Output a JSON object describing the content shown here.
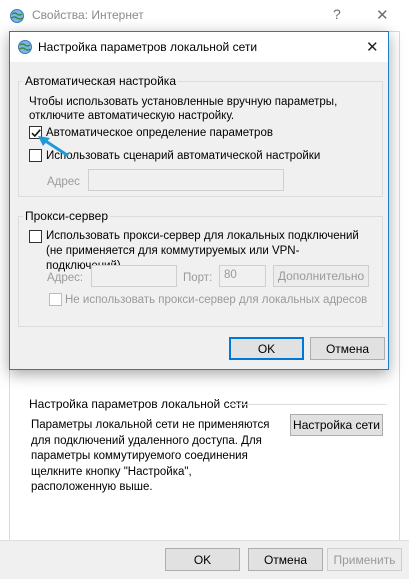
{
  "outer_window": {
    "title": "Свойства: Интернет",
    "help_glyph": "?",
    "close_glyph": "✕",
    "lan_section_heading": "Настройка параметров локальной сети",
    "lan_section_description": "Параметры локальной сети не применяются для подключений удаленного доступа. Для параметры коммутируемого соединения щелкните кнопку \"Настройка\", расположенную выше.",
    "lan_settings_button": "Настройка сети",
    "ok_button": "OK",
    "cancel_button": "Отмена",
    "apply_button": "Применить"
  },
  "dialog": {
    "title": "Настройка параметров локальной сети",
    "close_glyph": "✕",
    "auto_group": {
      "legend": "Автоматическая настройка",
      "description": "Чтобы использовать установленные вручную параметры, отключите автоматическую настройку.",
      "auto_detect_label": "Автоматическое определение параметров",
      "auto_detect_checked": true,
      "use_script_label": "Использовать сценарий автоматической настройки",
      "use_script_checked": false,
      "address_label": "Адрес",
      "address_value": ""
    },
    "proxy_group": {
      "legend": "Прокси-сервер",
      "use_proxy_label": "Использовать прокси-сервер для локальных подключений (не применяется для коммутируемых или VPN-подключений).",
      "use_proxy_checked": false,
      "address_label": "Адрес:",
      "address_value": "",
      "port_label": "Порт:",
      "port_value": "80",
      "advanced_button": "Дополнительно",
      "bypass_label": "Не использовать прокси-сервер для локальных адресов",
      "bypass_checked": false
    },
    "ok_button": "OK",
    "cancel_button": "Отмена"
  },
  "colors": {
    "accent": "#0078d7",
    "arrow": "#1e9bd7"
  },
  "icons": [
    "globe-network-icon",
    "checkmark-icon",
    "pointer-arrow-icon"
  ]
}
